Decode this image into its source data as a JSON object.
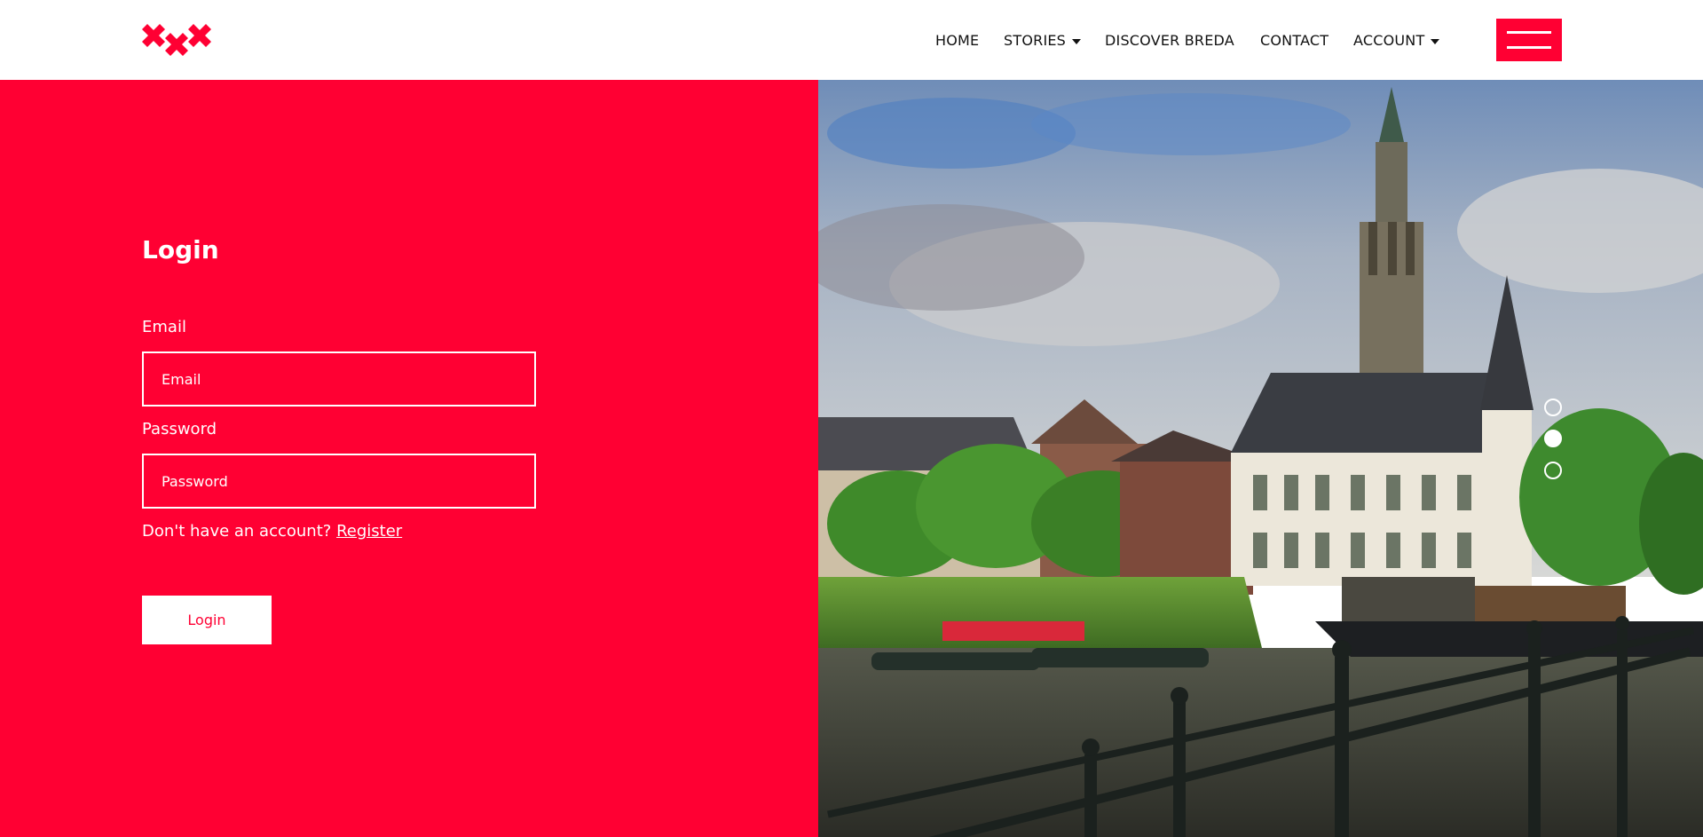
{
  "brand": {
    "logo_icon": "xxx-cross-logo-icon",
    "accent_color": "#ff0033"
  },
  "nav": {
    "items": [
      {
        "label": "HOME",
        "has_dropdown": false
      },
      {
        "label": "STORIES",
        "has_dropdown": true
      },
      {
        "label": "DISCOVER BREDA",
        "has_dropdown": false
      },
      {
        "label": "CONTACT",
        "has_dropdown": false
      },
      {
        "label": "ACCOUNT",
        "has_dropdown": true
      }
    ],
    "menu_icon": "hamburger-menu-icon"
  },
  "login": {
    "title": "Login",
    "email_label": "Email",
    "email_placeholder": "Email",
    "email_value": "",
    "password_label": "Password",
    "password_placeholder": "Password",
    "password_value": "",
    "no_account_text": "Don't have an account?",
    "register_link": "Register",
    "submit_label": "Login"
  },
  "hero": {
    "image_subject": "canal-with-church-tower-and-boats-photo",
    "slider": {
      "count": 3,
      "active_index": 1
    }
  }
}
